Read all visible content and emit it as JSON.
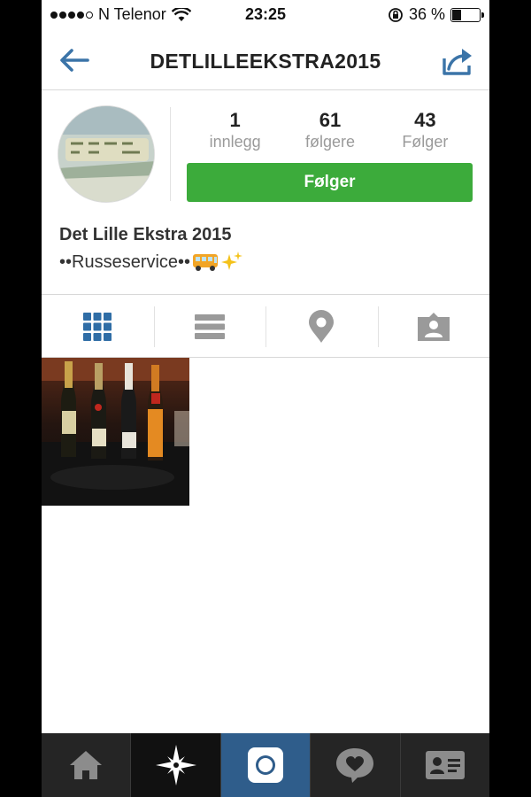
{
  "status_bar": {
    "carrier": "N Telenor",
    "time": "23:25",
    "battery_percent": "36 %",
    "battery_level": 0.36
  },
  "nav": {
    "title": "DETLILLEEKSTRA2015",
    "back_icon": "back-arrow-icon",
    "share_icon": "share-icon"
  },
  "profile": {
    "stats": [
      {
        "value": "1",
        "label": "innlegg"
      },
      {
        "value": "61",
        "label": "følgere"
      },
      {
        "value": "43",
        "label": "Følger"
      }
    ],
    "follow_button": "Følger",
    "display_name": "Det Lille Ekstra 2015",
    "bio_text": "••Russeservice••",
    "bio_emojis": [
      "bus-emoji",
      "sparkles-emoji"
    ]
  },
  "view_tabs": [
    {
      "icon": "grid-icon",
      "active": true
    },
    {
      "icon": "list-icon",
      "active": false
    },
    {
      "icon": "location-pin-icon",
      "active": false
    },
    {
      "icon": "tagged-person-icon",
      "active": false
    }
  ],
  "posts": [
    {
      "image": "champagne-bottles-photo"
    }
  ],
  "bottom_tabs": [
    {
      "icon": "home-icon",
      "active": false
    },
    {
      "icon": "explore-star-icon",
      "active": false
    },
    {
      "icon": "camera-icon",
      "active": true
    },
    {
      "icon": "activity-heart-icon",
      "active": false
    },
    {
      "icon": "profile-card-icon",
      "active": false
    }
  ],
  "colors": {
    "accent_blue": "#3b74a8",
    "follow_green": "#3cab3b",
    "tabbar_bg": "#252525",
    "tabbar_active": "#2f5d8b"
  }
}
